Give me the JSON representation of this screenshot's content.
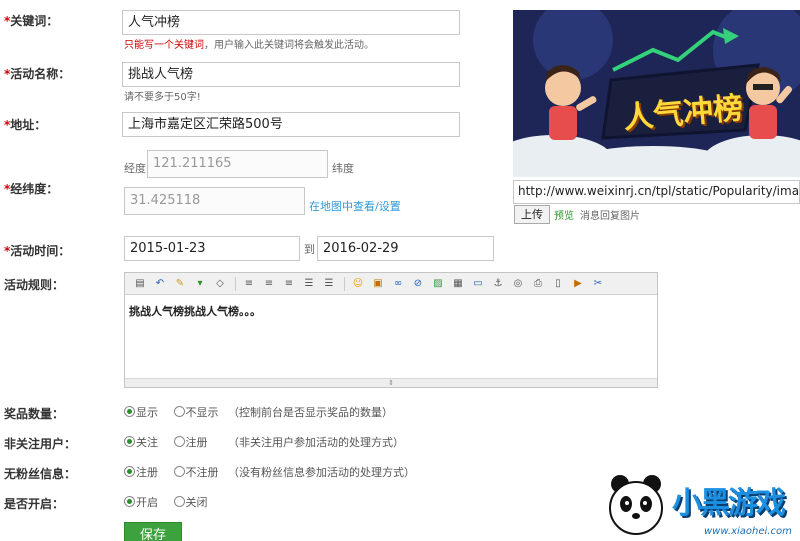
{
  "form": {
    "keyword": {
      "label": "关键词：",
      "value": "人气冲榜",
      "hint_red": "只能写一个关键词",
      "hint_rest": "，用户输入此关键词将会触发此活动。"
    },
    "name": {
      "label": "活动名称：",
      "value": "挑战人气榜",
      "hint": "请不要多于50字!"
    },
    "address": {
      "label": "地址：",
      "value": "上海市嘉定区汇荣路500号"
    },
    "coords": {
      "label": "经纬度：",
      "lng_label": "经度",
      "lng_value": "121.211165",
      "lat_label": "纬度",
      "lat_value": "31.425118",
      "map_link": "在地图中查看/设置"
    },
    "time": {
      "label": "活动时间：",
      "start": "2015-01-23",
      "to": "到",
      "end": "2016-02-29"
    },
    "rules": {
      "label": "活动规则：",
      "content": "挑战人气榜挑战人气榜。。。"
    },
    "prize": {
      "label": "奖品数量：",
      "opt_a": "显示",
      "opt_b": "不显示",
      "note": "（控制前台是否显示奖品的数量）"
    },
    "nonfollow": {
      "label": "非关注用户：",
      "opt_a": "关注",
      "opt_b": "注册",
      "note": "（非关注用户参加活动的处理方式）"
    },
    "nofans": {
      "label": "无粉丝信息：",
      "opt_a": "注册",
      "opt_b": "不注册",
      "note": "（没有粉丝信息参加活动的处理方式）"
    },
    "enabled": {
      "label": "是否开启：",
      "opt_a": "开启",
      "opt_b": "关闭"
    },
    "save": "保存"
  },
  "image": {
    "banner_text": "人气冲榜",
    "url": "http://www.weixinrj.cn/tpl/static/Popularity/ima",
    "upload": "上传",
    "preview": "预览",
    "reply_label": "消息回复图片"
  },
  "watermark": {
    "brand": "小黑游戏",
    "url": "www.xiaohei.com"
  },
  "colors": {
    "accent": "#3da23d",
    "required": "#d40000",
    "link": "#2e9ad6"
  },
  "toolbar_icons": [
    "source-icon",
    "undo-icon",
    "clear-format-icon",
    "paste-icon",
    "eraser-icon",
    "align-left-icon",
    "align-center-icon",
    "align-right-icon",
    "ordered-list-icon",
    "unordered-list-icon",
    "emoticon-icon",
    "image-icon",
    "link-icon",
    "unlink-icon",
    "picture-icon",
    "table-icon",
    "hr-icon",
    "anchor-icon",
    "preview-icon",
    "print-icon",
    "template-icon",
    "flash-icon",
    "cut-icon"
  ]
}
